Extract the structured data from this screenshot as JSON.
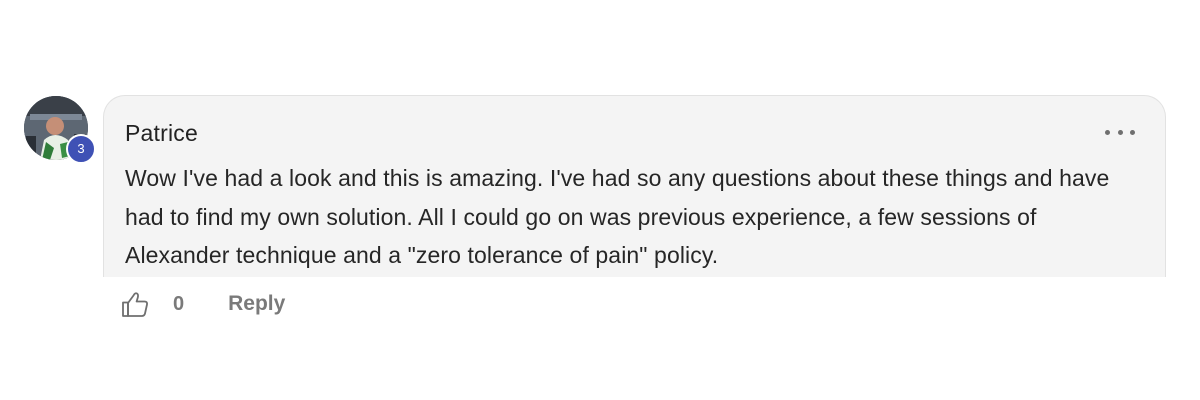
{
  "comment": {
    "author": "Patrice",
    "level_badge": "3",
    "text": "Wow I've had a look and this is amazing. I've had so any questions about these things and have had to find my own solution. All I could go on was previous experience, a few sessions of Alexander technique and a \"zero tolerance of pain\" policy.",
    "like_count": "0",
    "reply_label": "Reply"
  },
  "icons": {
    "like": "thumbs-up-icon",
    "more": "more-options-icon"
  },
  "colors": {
    "badge": "#3f51b5",
    "bubble_background": "#f4f4f4",
    "action_text": "#7a7a7a"
  }
}
